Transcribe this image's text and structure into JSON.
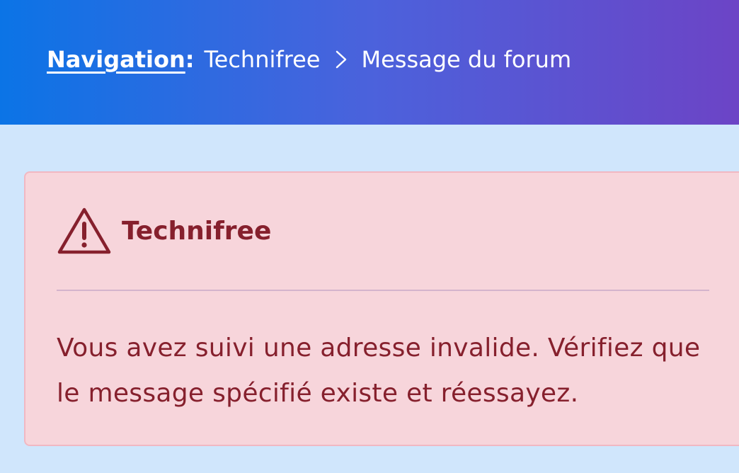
{
  "header": {
    "nav_label": "Navigation",
    "nav_colon": ":",
    "crumbs": [
      "Technifree",
      "Message du forum"
    ]
  },
  "alert": {
    "icon": "warning-triangle-icon",
    "title": "Technifree",
    "message": "Vous avez suivi une adresse invalide. Vérifiez que le message spécifié existe et réessayez."
  },
  "colors": {
    "header_gradient_start": "#0b74e6",
    "header_gradient_end": "#6c44c6",
    "page_background": "#d0e6fc",
    "alert_background": "#f7d5db",
    "alert_border": "#f1b8c2",
    "alert_text": "#86202d"
  }
}
